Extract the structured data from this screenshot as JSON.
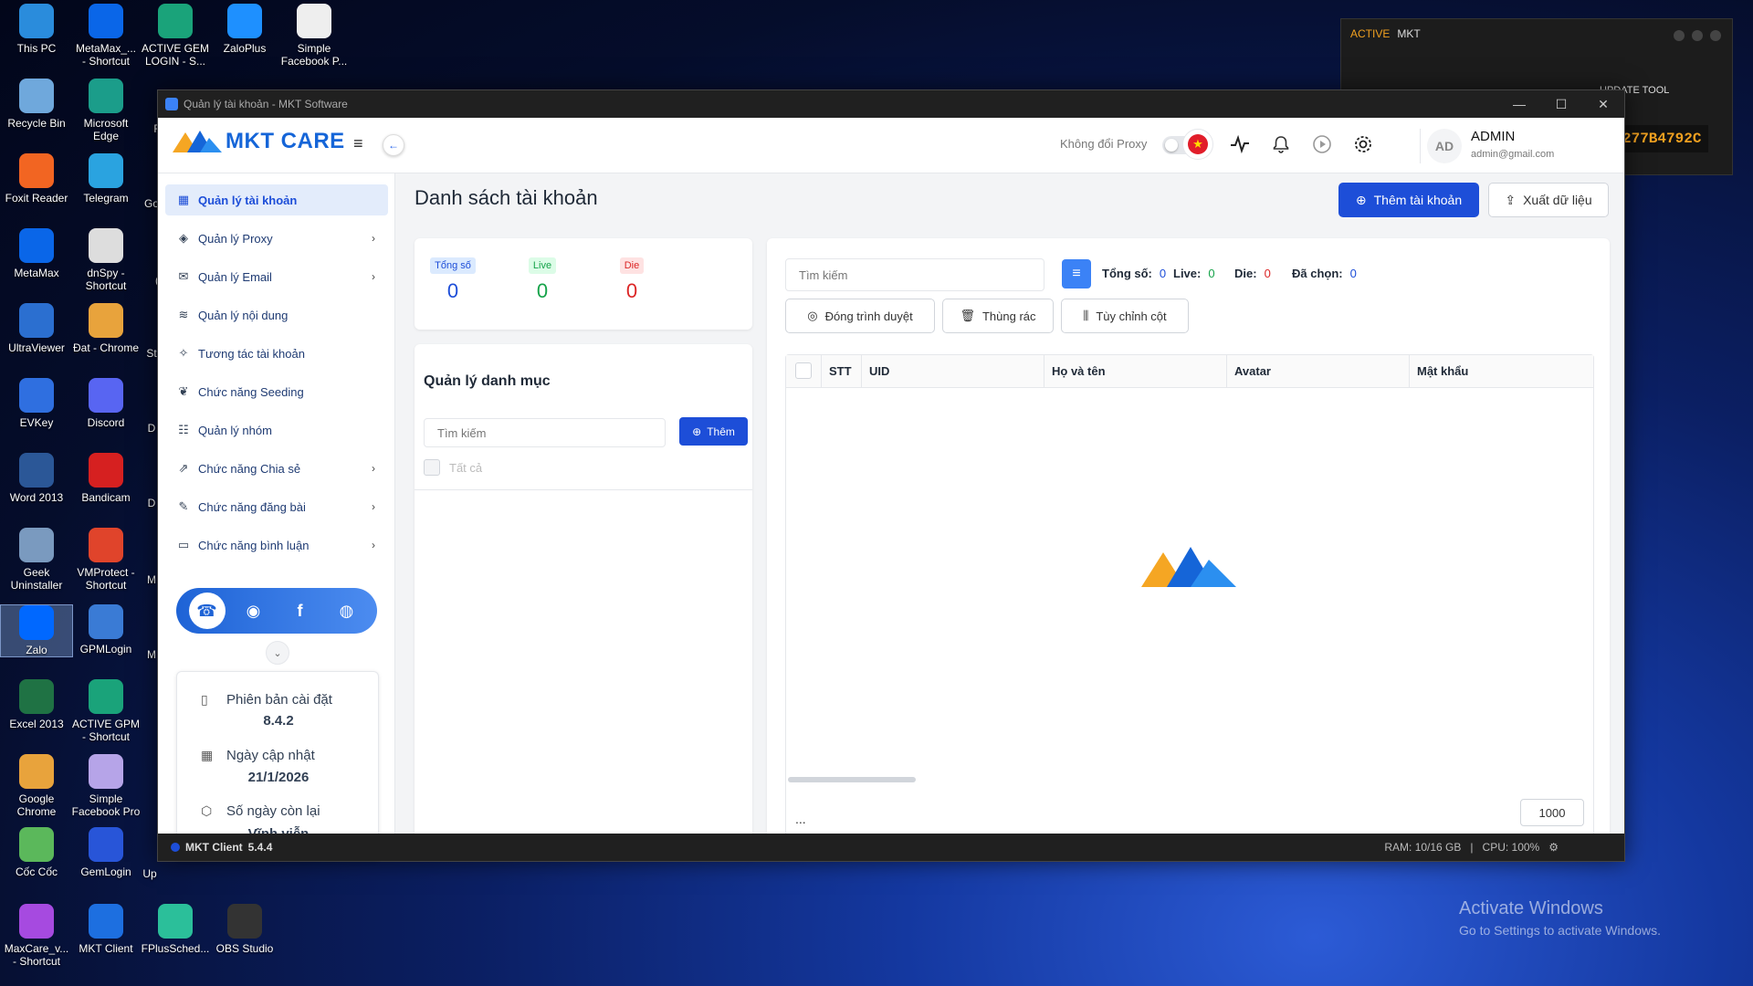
{
  "desktop": {
    "icons": [
      {
        "label": "This PC",
        "icon": "monitor-icon"
      },
      {
        "label": "MetaMax_...\n- Shortcut",
        "icon": "meta-icon"
      },
      {
        "label": "ACTIVE GEM\nLOGIN - S...",
        "icon": "gem-icon"
      },
      {
        "label": "ZaloPlus",
        "icon": "zalo-plus-icon"
      },
      {
        "label": "Simple\nFacebook P...",
        "icon": "file-icon"
      },
      {
        "label": "Recycle Bin",
        "icon": "recycle-icon"
      },
      {
        "label": "Microsoft\nEdge",
        "icon": "edge-icon"
      },
      {
        "label": "Foxit Reader",
        "icon": "pdf-icon"
      },
      {
        "label": "Telegram",
        "icon": "telegram-icon"
      },
      {
        "label": "MetaMax",
        "icon": "meta-icon"
      },
      {
        "label": "dnSpy -\nShortcut",
        "icon": "dnspy-icon"
      },
      {
        "label": "UltraViewer",
        "icon": "ultraviewer-icon"
      },
      {
        "label": "Đat - Chrome",
        "icon": "chrome-icon"
      },
      {
        "label": "EVKey",
        "icon": "evkey-icon"
      },
      {
        "label": "Discord",
        "icon": "discord-icon"
      },
      {
        "label": "Word 2013",
        "icon": "word-icon"
      },
      {
        "label": "Bandicam",
        "icon": "record-icon"
      },
      {
        "label": "Geek\nUninstaller",
        "icon": "geek-icon"
      },
      {
        "label": "VMProtect -\nShortcut",
        "icon": "vmprotect-icon"
      },
      {
        "label": "Zalo",
        "icon": "zalo-icon"
      },
      {
        "label": "GPMLogin",
        "icon": "gpm-icon"
      },
      {
        "label": "Excel 2013",
        "icon": "excel-icon"
      },
      {
        "label": "ACTIVE GPM\n- Shortcut",
        "icon": "gem-icon"
      },
      {
        "label": "Google\nChrome",
        "icon": "chrome-icon"
      },
      {
        "label": "Simple\nFacebook Pro",
        "icon": "fbpro-icon"
      },
      {
        "label": "Cốc Cốc",
        "icon": "coccoc-icon"
      },
      {
        "label": "GemLogin",
        "icon": "gemlogin-icon"
      },
      {
        "label": "MaxCare_v...\n- Shortcut",
        "icon": "maxcare-icon"
      },
      {
        "label": "MKT Client",
        "icon": "mkt-client-icon"
      },
      {
        "label": "FPlusSched...",
        "icon": "fplus-icon"
      },
      {
        "label": "OBS Studio",
        "icon": "obs-icon"
      }
    ],
    "partial_labels": [
      "Go",
      "St",
      "D",
      "D",
      "M",
      "M",
      "Up",
      "F",
      "("
    ],
    "activate_title": "Activate Windows",
    "activate_sub": "Go to Settings to activate Windows."
  },
  "bg_window": {
    "active": "ACTIVE",
    "title": "MKT",
    "update": "UPDATE TOOL",
    "key": "277B4792C"
  },
  "window": {
    "title": "Quản lý tài khoản - MKT Software",
    "minimize": "—",
    "maximize": "☐",
    "close": "✕"
  },
  "header": {
    "brand": "MKT CARE",
    "proxy_label": "Không đổi Proxy",
    "avatar_initials": "AD",
    "user_name": "ADMIN",
    "user_email": "admin@gmail.com"
  },
  "sidebar": {
    "items": [
      {
        "label": "Quản lý tài khoản",
        "icon": "grid-icon",
        "active": true,
        "chevron": false
      },
      {
        "label": "Quản lý Proxy",
        "icon": "layers-icon",
        "chevron": true
      },
      {
        "label": "Quản lý Email",
        "icon": "mail-icon",
        "chevron": true
      },
      {
        "label": "Quản lý nội dung",
        "icon": "content-icon",
        "chevron": false
      },
      {
        "label": "Tương tác tài khoản",
        "icon": "interact-icon",
        "chevron": false
      },
      {
        "label": "Chức năng Seeding",
        "icon": "seeding-icon",
        "chevron": false
      },
      {
        "label": "Quản lý nhóm",
        "icon": "group-icon",
        "chevron": false
      },
      {
        "label": "Chức năng Chia sẻ",
        "icon": "share-icon",
        "chevron": true
      },
      {
        "label": "Chức năng đăng bài",
        "icon": "post-icon",
        "chevron": true
      },
      {
        "label": "Chức năng bình luận",
        "icon": "comment-icon",
        "chevron": true
      }
    ],
    "social": [
      "support-icon",
      "zalo-icon",
      "facebook-icon",
      "globe-icon"
    ],
    "info": {
      "version_label": "Phiên bản cài đặt",
      "version_value": "8.4.2",
      "update_label": "Ngày cập nhật",
      "update_value": "21/1/2026",
      "days_label": "Số ngày còn lại",
      "days_value": "Vĩnh viễn"
    }
  },
  "main": {
    "page_title": "Danh sách tài khoản",
    "add_account": "Thêm tài khoản",
    "export": "Xuất dữ liệu",
    "stats": [
      {
        "label": "Tổng số",
        "value": "0",
        "color": "#1d4ed8",
        "bg": "#dbeafe"
      },
      {
        "label": "Live",
        "value": "0",
        "color": "#16a34a",
        "bg": "#dcfce7"
      },
      {
        "label": "Die",
        "value": "0",
        "color": "#dc2626",
        "bg": "#fee2e2"
      }
    ],
    "category": {
      "title": "Quản lý danh mục",
      "search_placeholder": "Tìm kiếm",
      "add": "Thêm",
      "all": "Tất cả"
    },
    "accounts": {
      "search_placeholder": "Tìm kiếm",
      "total_label": "Tổng số:",
      "total_value": "0",
      "live_label": "Live:",
      "live_value": "0",
      "die_label": "Die:",
      "die_value": "0",
      "selected_label": "Đã chọn:",
      "selected_value": "0",
      "close_browser": "Đóng trình duyệt",
      "trash": "Thùng rác",
      "customize_cols": "Tùy chỉnh cột",
      "columns": [
        "STT",
        "UID",
        "Họ và tên",
        "Avatar",
        "Mật khẩu"
      ],
      "pager_dots": "...",
      "page_size": "1000"
    }
  },
  "statusbar": {
    "client": "MKT Client",
    "client_version": "5.4.4",
    "ram": "RAM: 10/16 GB",
    "sep": "|",
    "cpu": "CPU: 100%"
  },
  "colors": {
    "primary": "#1d4ed8",
    "live": "#16a34a",
    "die": "#dc2626"
  }
}
